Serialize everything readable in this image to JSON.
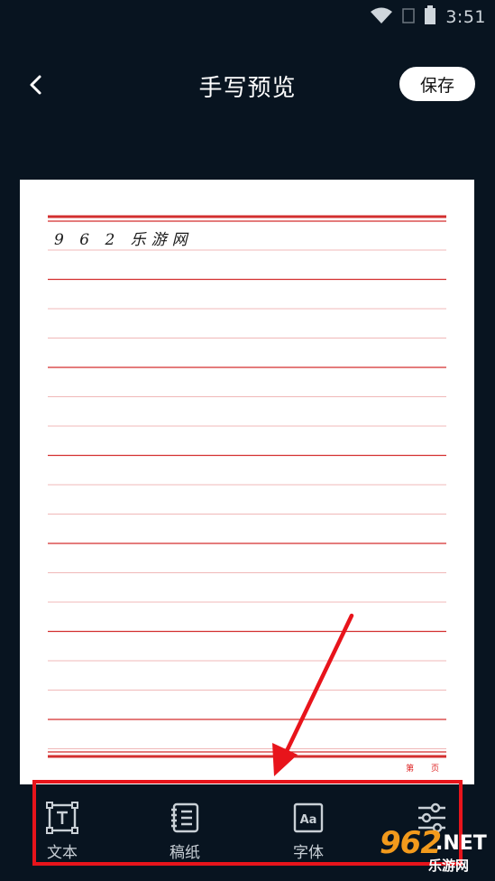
{
  "status_bar": {
    "time": "3:51"
  },
  "header": {
    "title": "手写预览",
    "save_label": "保存"
  },
  "paper": {
    "text": "9 6 2 乐游网",
    "page_label": "第 页"
  },
  "toolbar": {
    "items": [
      {
        "label": "文本",
        "icon": "text-box-icon"
      },
      {
        "label": "稿纸",
        "icon": "notebook-icon"
      },
      {
        "label": "字体",
        "icon": "font-aa-icon"
      },
      {
        "label": "",
        "icon": "sliders-icon"
      }
    ]
  },
  "watermark": {
    "number": "962",
    "domain": ".NET",
    "name": "乐游网"
  },
  "colors": {
    "background": "#081420",
    "paper_rule": "#d32f2f",
    "highlight": "#e8141b",
    "watermark_orange": "#f29a1c"
  }
}
